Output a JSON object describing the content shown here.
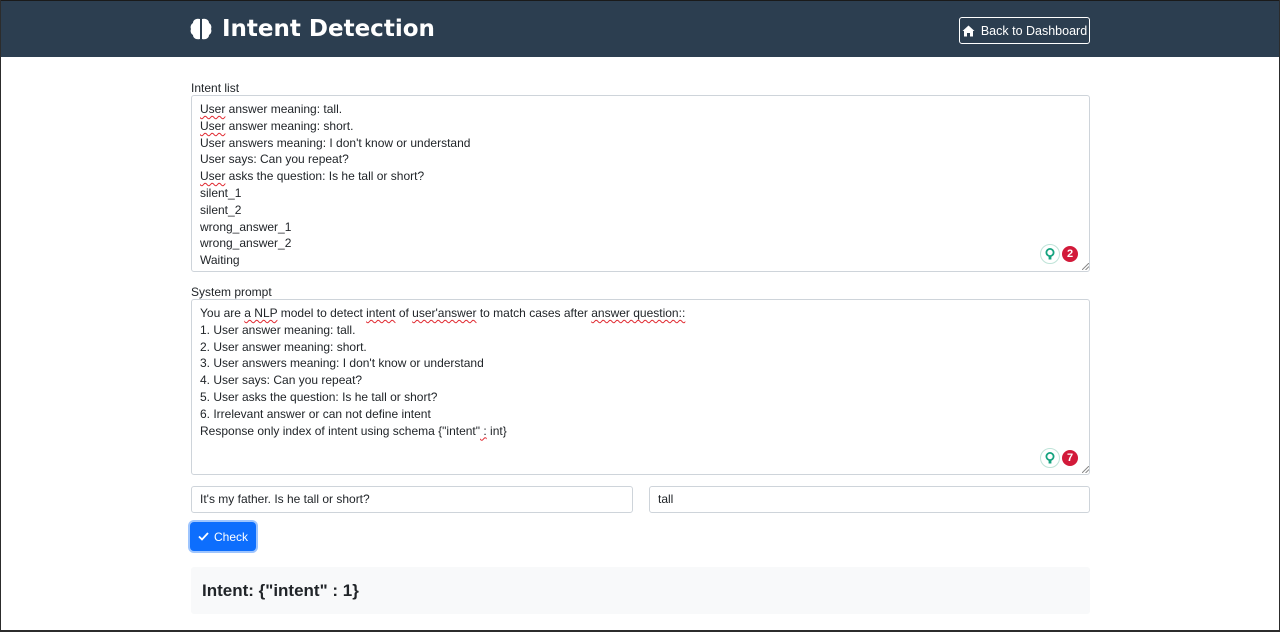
{
  "header": {
    "title": "Intent Detection",
    "back_label": "Back to Dashboard",
    "bg_color": "#2c3e50"
  },
  "intent_list": {
    "label": "Intent list",
    "lines": [
      [
        {
          "t": "User",
          "sq": true
        },
        {
          "t": " answer meaning: tall."
        }
      ],
      [
        {
          "t": "User",
          "sq": true
        },
        {
          "t": " answer meaning: short."
        }
      ],
      [
        {
          "t": "User answers meaning: I don't know or understand"
        }
      ],
      [
        {
          "t": "User says: Can you repeat?"
        }
      ],
      [
        {
          "t": "User",
          "sq": true
        },
        {
          "t": " asks the question: Is he tall or short?"
        }
      ],
      [
        {
          "t": "silent_1"
        }
      ],
      [
        {
          "t": "silent_2"
        }
      ],
      [
        {
          "t": "wrong_answer_1"
        }
      ],
      [
        {
          "t": "wrong_answer_2"
        }
      ],
      [
        {
          "t": "Waiting"
        }
      ]
    ],
    "grammar_count": "2"
  },
  "system_prompt": {
    "label": "System prompt",
    "lines": [
      [
        {
          "t": "You are "
        },
        {
          "t": "a NLP",
          "sq": true
        },
        {
          "t": " model to detect "
        },
        {
          "t": "intent",
          "sq": true
        },
        {
          "t": " of "
        },
        {
          "t": "user'answer",
          "sq": true
        },
        {
          "t": " to match cases after "
        },
        {
          "t": "answer question::",
          "sq": true
        }
      ],
      [
        {
          "t": "1. User answer meaning: tall."
        }
      ],
      [
        {
          "t": "2. User answer meaning: short."
        }
      ],
      [
        {
          "t": "3. User answers meaning: I don't know or understand"
        }
      ],
      [
        {
          "t": "4. User says: Can you repeat?"
        }
      ],
      [
        {
          "t": "5. User asks the question: Is he tall or short?"
        }
      ],
      [
        {
          "t": "6. Irrelevant answer or can not define intent"
        }
      ],
      [
        {
          "t": "Response only index of intent using schema {\"intent\""
        },
        {
          "t": " :",
          "sq": true
        },
        {
          "t": " int}"
        }
      ]
    ],
    "grammar_count": "7"
  },
  "question_input": {
    "value": "It's my father. Is he tall or short?"
  },
  "answer_input": {
    "value": "tall"
  },
  "check_button": {
    "label": "Check",
    "color": "#0d6efd"
  },
  "result": {
    "text": "Intent: {\"intent\" : 1}"
  }
}
